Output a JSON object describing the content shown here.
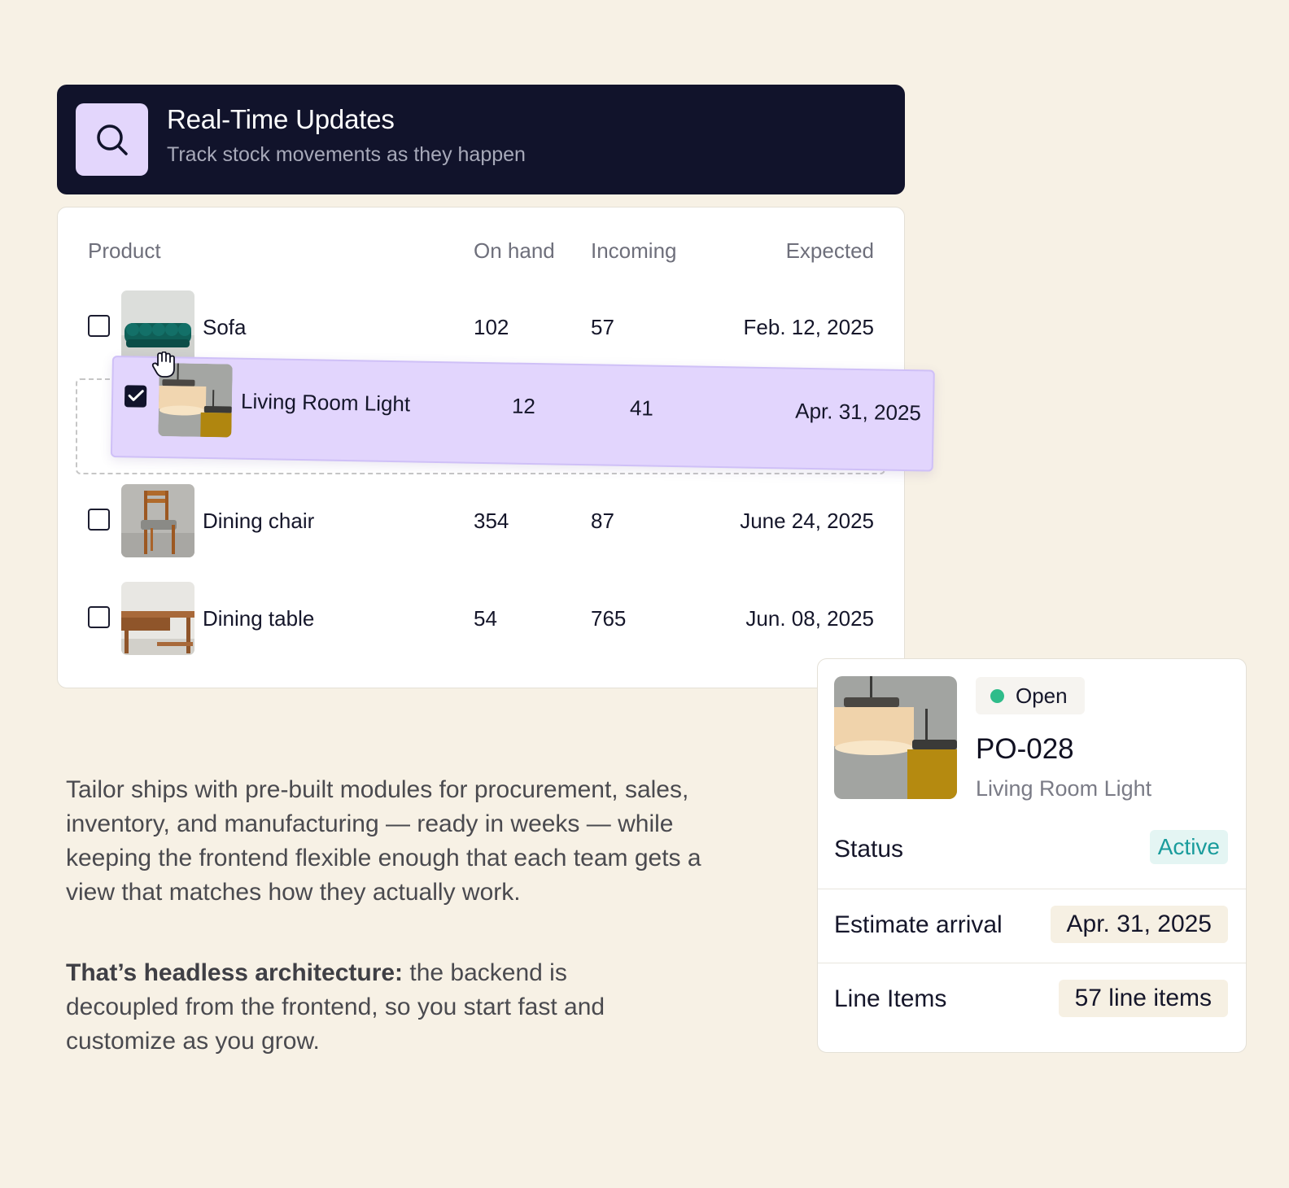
{
  "banner": {
    "icon": "search-icon",
    "title": "Real-Time Updates",
    "subtitle": "Track stock movements as they happen"
  },
  "table": {
    "headers": {
      "product": "Product",
      "on_hand": "On hand",
      "incoming": "Incoming",
      "expected": "Expected"
    },
    "rows": [
      {
        "name": "Sofa",
        "on_hand": "102",
        "incoming": "57",
        "expected": "Feb. 12, 2025",
        "checked": false,
        "image": "sofa-thumbnail"
      },
      {
        "name": "Living Room Light",
        "on_hand": "12",
        "incoming": "41",
        "expected": "Apr. 31, 2025",
        "checked": true,
        "image": "pendant-light-thumbnail",
        "dragging": true
      },
      {
        "name": "Dining chair",
        "on_hand": "354",
        "incoming": "87",
        "expected": "June 24, 2025",
        "checked": false,
        "image": "chair-thumbnail"
      },
      {
        "name": "Dining table",
        "on_hand": "54",
        "incoming": "765",
        "expected": "Jun. 08, 2025",
        "checked": false,
        "image": "desk-thumbnail"
      }
    ]
  },
  "copy": {
    "paragraph1": "Tailor ships with pre-built modules for procurement, sales, inventory, and manufacturing — ready in weeks — while keeping the frontend flexible enough that each team gets a view that matches how they actually work.",
    "paragraph2_bold": "That’s headless architecture:",
    "paragraph2_rest": " the backend is decoupled from the frontend, so you start fast and customize as you grow."
  },
  "po_card": {
    "badge": "Open",
    "badge_color": "#2fbc8a",
    "id": "PO-028",
    "product": "Living Room Light",
    "status_label": "Status",
    "status_value": "Active",
    "arrival_label": "Estimate arrival",
    "arrival_value": "Apr. 31, 2025",
    "items_label": "Line Items",
    "items_value": "57 line items"
  },
  "colors": {
    "background": "#f7f1e5",
    "banner": "#11132b",
    "accent_lavender": "#e2d5fd",
    "status_teal": "#1a9c9c"
  }
}
